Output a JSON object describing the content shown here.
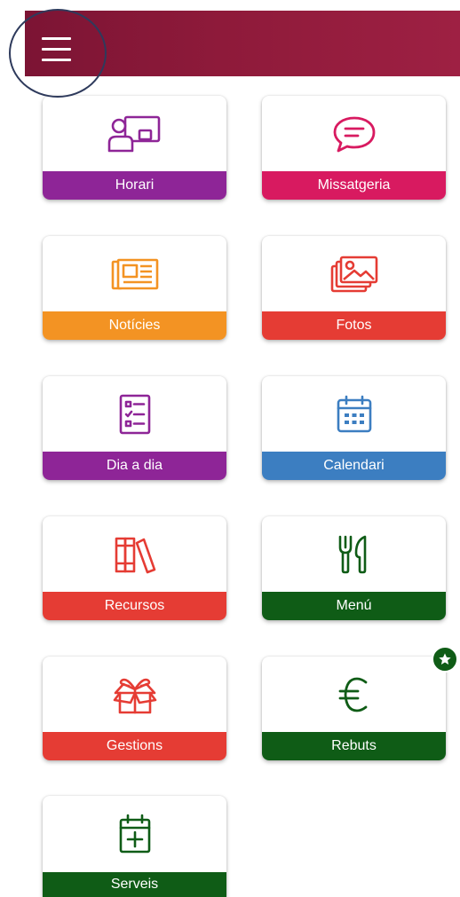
{
  "header": {
    "menu_icon": "hamburger-menu-icon",
    "bar_color": "#8e1a3a"
  },
  "tiles": [
    {
      "label": "Horari",
      "icon": "schedule-presenter-icon",
      "color": "#8e2597"
    },
    {
      "label": "Missatgeria",
      "icon": "chat-bubble-icon",
      "color": "#d81a60"
    },
    {
      "label": "Notícies",
      "icon": "newspaper-icon",
      "color": "#f39323"
    },
    {
      "label": "Fotos",
      "icon": "photo-gallery-icon",
      "color": "#e53c34"
    },
    {
      "label": "Dia a dia",
      "icon": "checklist-icon",
      "color": "#8e2597"
    },
    {
      "label": "Calendari",
      "icon": "calendar-icon",
      "color": "#3c7ec1"
    },
    {
      "label": "Recursos",
      "icon": "books-icon",
      "color": "#e53c34"
    },
    {
      "label": "Menú",
      "icon": "cutlery-icon",
      "color": "#0f5c16"
    },
    {
      "label": "Gestions",
      "icon": "gift-box-icon",
      "color": "#e53c34"
    },
    {
      "label": "Rebuts",
      "icon": "euro-icon",
      "color": "#0f5c16"
    },
    {
      "label": "Serveis",
      "icon": "calendar-add-icon",
      "color": "#0f5c16"
    }
  ],
  "badge": {
    "icon": "star-icon",
    "color": "#0f5c16"
  }
}
